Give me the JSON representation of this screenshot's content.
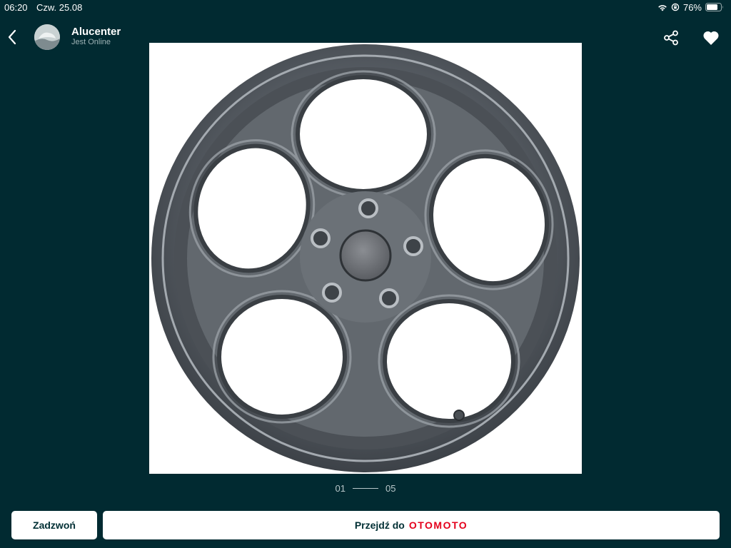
{
  "status_bar": {
    "time": "06:20",
    "date": "Czw. 25.08",
    "battery": "76%",
    "icons": [
      "wifi-icon",
      "orientation-lock-icon",
      "battery-icon"
    ]
  },
  "header": {
    "seller_name": "Alucenter",
    "seller_status": "Jest Online",
    "icons": [
      "back-chevron-icon",
      "avatar",
      "share-icon",
      "heart-icon"
    ]
  },
  "gallery": {
    "current": "01",
    "total": "05",
    "image": "alloy-wheel-photo"
  },
  "actions": {
    "call_label": "Zadzwoń",
    "goto_label": "Przejdź do",
    "brand": "OTOMOTO"
  },
  "colors": {
    "background": "#012a31",
    "button_bg": "#ffffff",
    "button_text": "#002f34",
    "brand": "#e4001c"
  }
}
